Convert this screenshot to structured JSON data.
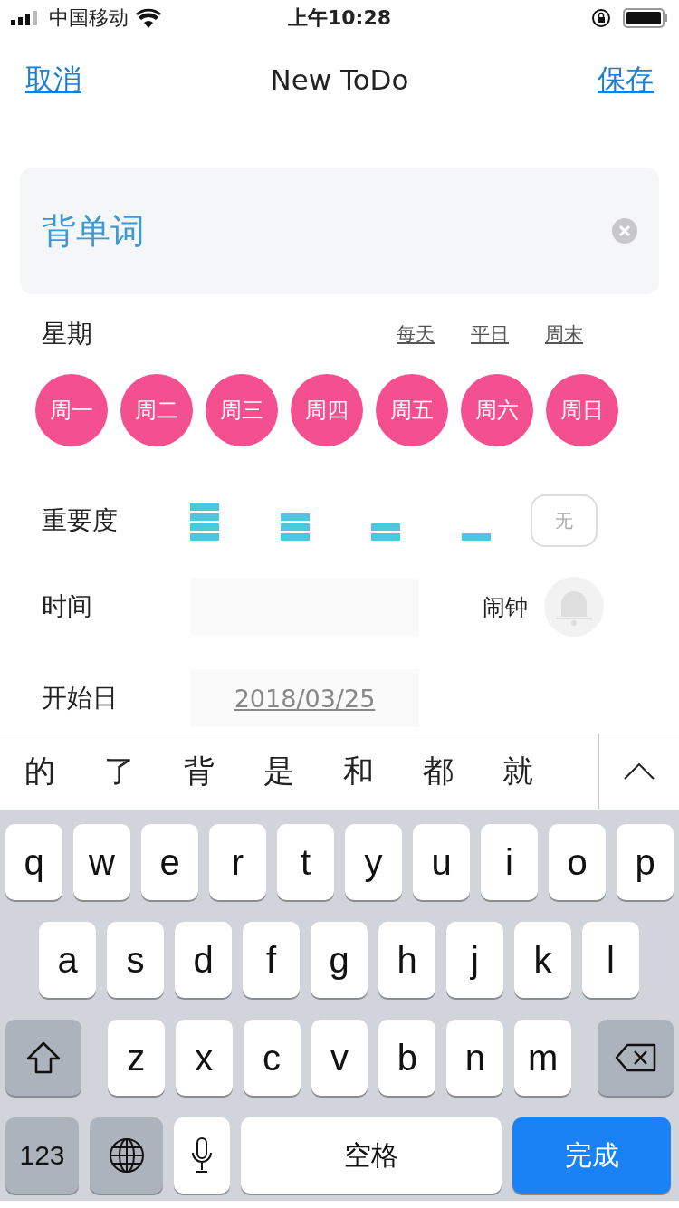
{
  "status_bar": {
    "carrier": "中国移动",
    "time": "上午10:28"
  },
  "nav": {
    "cancel": "取消",
    "title": "New ToDo",
    "save": "保存"
  },
  "title_field": {
    "value": "背单词"
  },
  "weekdays": {
    "label": "星期",
    "presets": [
      "每天",
      "平日",
      "周末"
    ],
    "days": [
      {
        "label": "周一",
        "selected": true
      },
      {
        "label": "周二",
        "selected": true
      },
      {
        "label": "周三",
        "selected": true
      },
      {
        "label": "周四",
        "selected": true
      },
      {
        "label": "周五",
        "selected": true
      },
      {
        "label": "周六",
        "selected": true
      },
      {
        "label": "周日",
        "selected": true
      }
    ]
  },
  "importance": {
    "label": "重要度",
    "options": [
      {
        "kind": "bars"
      },
      {
        "kind": "bars"
      },
      {
        "kind": "bars"
      },
      {
        "kind": "bars"
      },
      {
        "kind": "text",
        "text": "无"
      }
    ]
  },
  "time": {
    "label": "时间",
    "alarm_label": "闹钟"
  },
  "start_date": {
    "label": "开始日",
    "value": "2018/03/25"
  },
  "candidates": [
    "的",
    "了",
    "背",
    "是",
    "和",
    "都",
    "就"
  ],
  "keyboard": {
    "rows": [
      [
        "q",
        "w",
        "e",
        "r",
        "t",
        "y",
        "u",
        "i",
        "o",
        "p"
      ],
      [
        "a",
        "s",
        "d",
        "f",
        "g",
        "h",
        "j",
        "k",
        "l"
      ],
      [
        "z",
        "x",
        "c",
        "v",
        "b",
        "n",
        "m"
      ]
    ],
    "numbers_key": "123",
    "space_key": "空格",
    "done_key": "完成"
  }
}
